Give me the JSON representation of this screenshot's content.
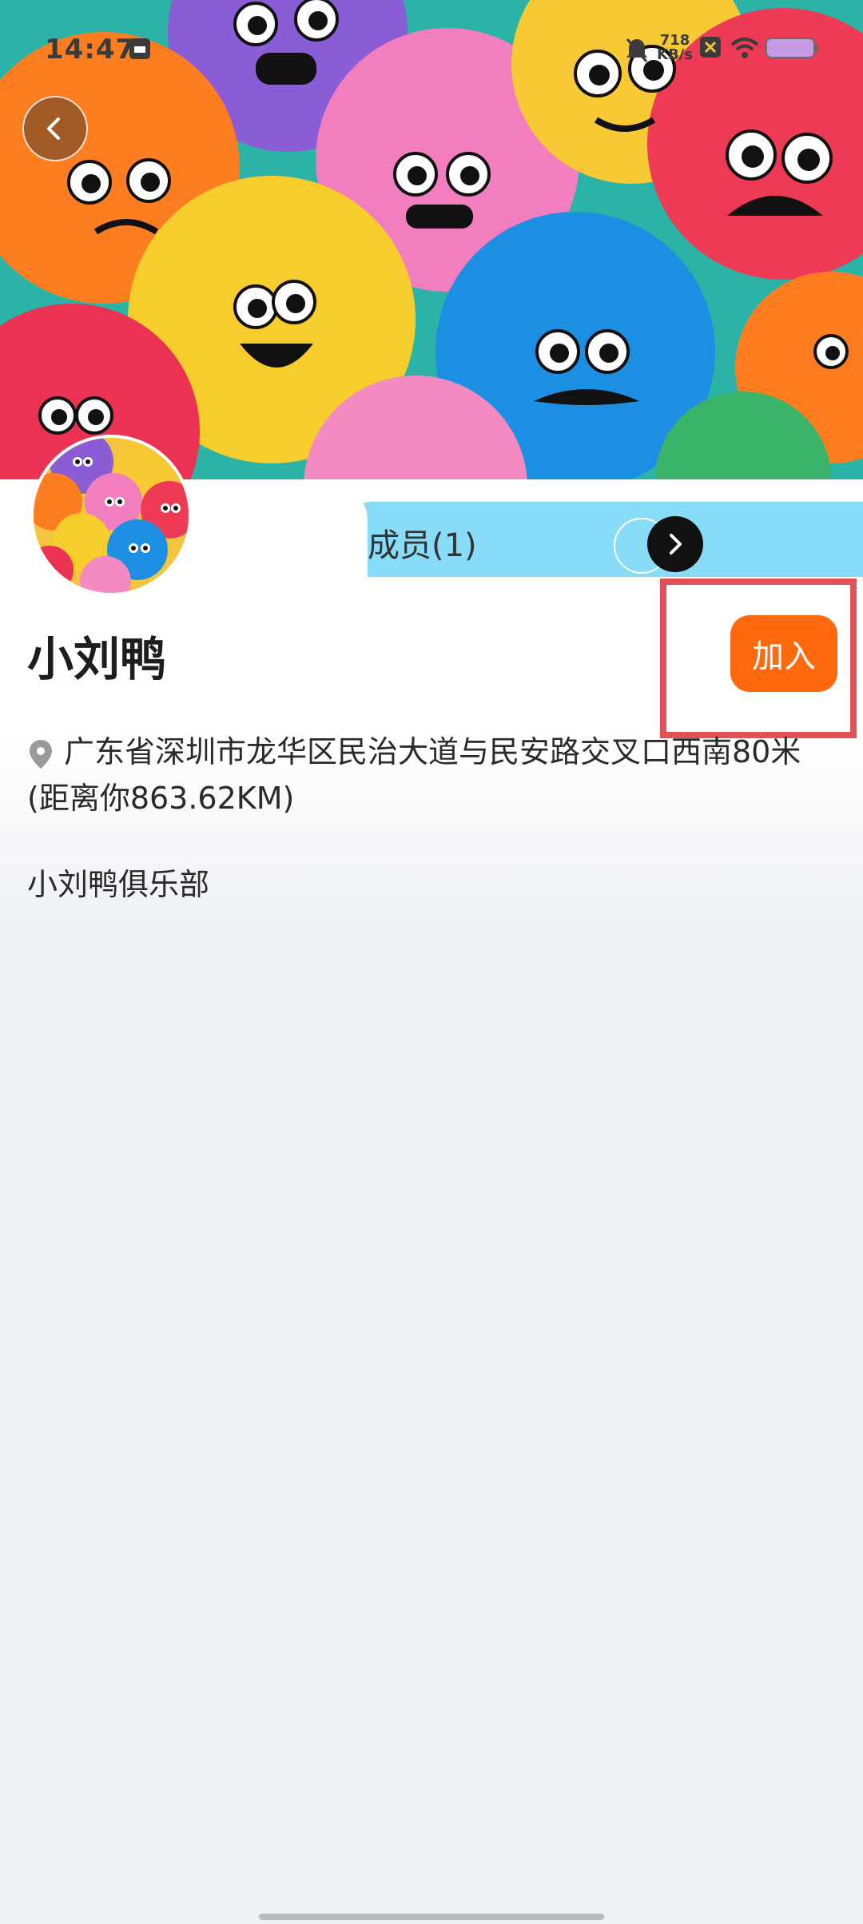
{
  "status_bar": {
    "time": "14:47",
    "net_speed_value": "718",
    "net_speed_unit": "KB/s"
  },
  "club": {
    "name": "小刘鸭",
    "address": "广东省深圳市龙华区民治大道与民安路交叉口西南80米",
    "distance": "(距离你863.62KM)",
    "description": "小刘鸭俱乐部"
  },
  "members": {
    "label": "成员(1)"
  },
  "actions": {
    "join_label": "加入"
  },
  "colors": {
    "accent": "#ff6a0e",
    "members_bar": "#88dcf7",
    "highlight": "#e25156"
  },
  "icons": [
    "back-arrow-icon",
    "chevron-right-icon",
    "location-pin-icon",
    "mute-bell-icon",
    "wifi-icon",
    "battery-icon"
  ]
}
